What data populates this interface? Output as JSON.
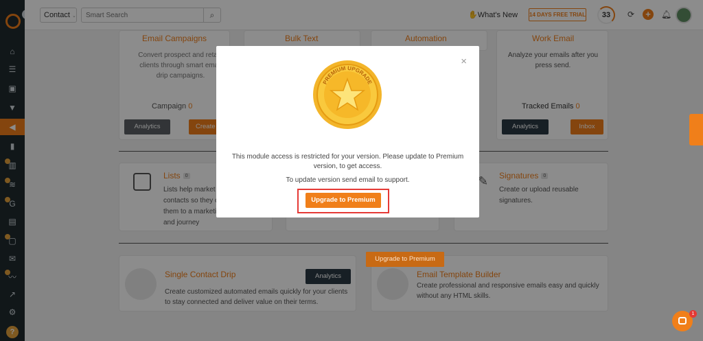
{
  "topbar": {
    "contact_select": "Contact",
    "search_placeholder": "Smart Search",
    "whats_new": "What's New",
    "trial": "14 DAYS FREE TRIAL",
    "counter": "33"
  },
  "cards_row1": [
    {
      "title": "Email Campaigns",
      "text_lines": [
        "Convert prospect and retain",
        "clients through smart email",
        "drip campaigns."
      ],
      "stat": "Campaign",
      "stat_value": "0",
      "btn1": "Analytics",
      "btn2": "Create"
    },
    {
      "title": "Bulk Text"
    },
    {
      "title": "Automation"
    },
    {
      "title": "Work Email",
      "text_lines": [
        "Analyze your emails after you",
        "press send."
      ],
      "stat": "Tracked Emails",
      "stat_value": "0",
      "btn1": "Analytics",
      "btn2": "Inbox"
    }
  ],
  "cards_row2": {
    "lists": {
      "title": "Lists",
      "count": "0",
      "text_lines": [
        "Lists help market",
        "contacts so they c",
        "them to a marketi",
        "and journey"
      ]
    },
    "signatures": {
      "title": "Signatures",
      "count": "0",
      "text_lines": [
        "Create or upload reusable",
        "signatures."
      ]
    }
  },
  "cards_row3": {
    "single_drip": {
      "title": "Single Contact Drip",
      "btn": "Analytics",
      "text_lines": [
        "Create customized automated emails quickly for your clients",
        "to stay connected and deliver value on their terms."
      ]
    },
    "template_builder": {
      "title": "Email Template Builder",
      "upgrade": "Upgrade to Premium",
      "text_lines": [
        "Create professional and responsive emails easy and quickly",
        "without any HTML skills."
      ]
    }
  },
  "modal": {
    "medal_text": "PREMIUM UPGRADE",
    "message": "This module access is restricted for your version. Please update to Premium version, to get access.",
    "message2": "To update version send email to support.",
    "button": "Upgrade to Premium"
  },
  "chat_badge": "1",
  "help_label": "?",
  "colors": {
    "accent": "#f07f1a",
    "sidebar": "#1f2a2f",
    "highlight": "#e53935"
  }
}
